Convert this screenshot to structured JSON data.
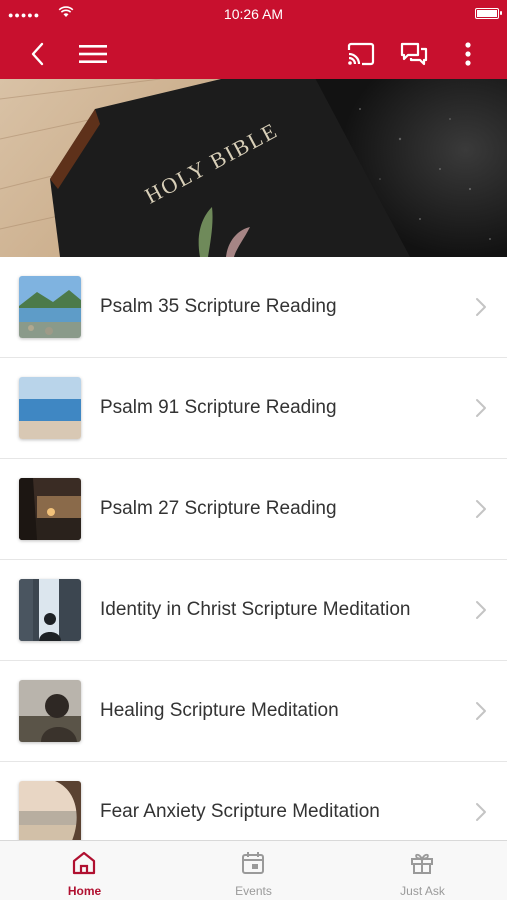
{
  "status_bar": {
    "time": "10:26 AM"
  },
  "nav": {
    "icons": [
      "back-chevron-icon",
      "hamburger-menu-icon",
      "cast-icon",
      "chat-icon",
      "more-vertical-icon"
    ]
  },
  "hero": {
    "book_text": "HOLY BIBLE"
  },
  "list": {
    "items": [
      {
        "title": "Psalm 35 Scripture Reading"
      },
      {
        "title": "Psalm 91 Scripture Reading"
      },
      {
        "title": "Psalm 27 Scripture Reading"
      },
      {
        "title": "Identity in Christ Scripture Meditation"
      },
      {
        "title": "Healing Scripture Meditation"
      },
      {
        "title": "Fear Anxiety Scripture Meditation"
      }
    ]
  },
  "tabbar": {
    "tabs": [
      {
        "label": "Home",
        "icon": "home-icon",
        "active": true
      },
      {
        "label": "Events",
        "icon": "calendar-icon",
        "active": false
      },
      {
        "label": "Just Ask",
        "icon": "gift-icon",
        "active": false
      }
    ]
  },
  "colors": {
    "brand": "#c8102e",
    "tab_active": "#b01030",
    "tab_inactive": "#9a9a9a"
  }
}
